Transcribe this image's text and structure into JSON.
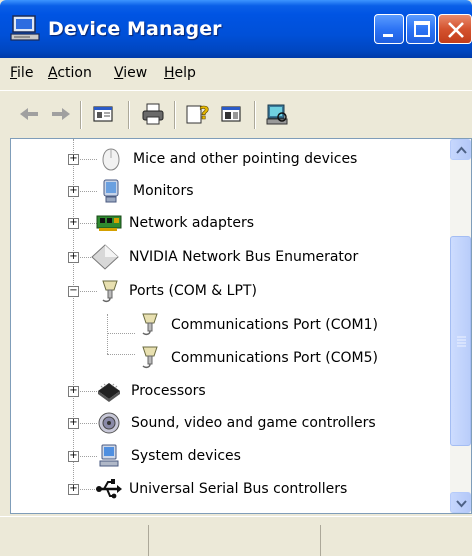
{
  "window": {
    "title": "Device Manager",
    "title_icon": "computer-icon",
    "buttons": [
      "minimize-icon",
      "maximize-icon",
      "close-icon"
    ]
  },
  "menu": [
    {
      "label": "File",
      "accel": "F",
      "rest": "ile"
    },
    {
      "label": "Action",
      "accel": "A",
      "rest": "ction"
    },
    {
      "label": "View",
      "accel": "V",
      "rest": "iew"
    },
    {
      "label": "Help",
      "accel": "H",
      "rest": "elp"
    }
  ],
  "toolbar": {
    "icons": [
      "back-arrow-icon",
      "forward-arrow-icon",
      "properties-icon",
      "print-icon",
      "help-icon",
      "view-icon",
      "scan-hardware-icon"
    ]
  },
  "tree": {
    "items": [
      {
        "label": "Mice and other pointing devices",
        "expander": "+",
        "icon": "mouse-icon"
      },
      {
        "label": "Monitors",
        "expander": "+",
        "icon": "monitor-icon"
      },
      {
        "label": "Network adapters",
        "expander": "+",
        "icon": "network-card-icon"
      },
      {
        "label": "NVIDIA Network Bus Enumerator",
        "expander": "+",
        "icon": "diamond-device-icon"
      },
      {
        "label": "Ports (COM & LPT)",
        "expander": "−",
        "icon": "port-icon"
      },
      {
        "label": "Communications Port (COM1)",
        "expander": "",
        "icon": "port-icon"
      },
      {
        "label": "Communications Port (COM5)",
        "expander": "",
        "icon": "port-icon"
      },
      {
        "label": "Processors",
        "expander": "+",
        "icon": "processor-icon"
      },
      {
        "label": "Sound, video and game controllers",
        "expander": "+",
        "icon": "speaker-icon"
      },
      {
        "label": "System devices",
        "expander": "+",
        "icon": "computer-icon"
      },
      {
        "label": "Universal Serial Bus controllers",
        "expander": "+",
        "icon": "usb-icon"
      }
    ]
  },
  "scrollbar": {
    "position_fraction": 0.62
  },
  "colors": {
    "titlebar": "#0054e3",
    "chrome": "#ece9d8",
    "close": "#d4532f"
  }
}
